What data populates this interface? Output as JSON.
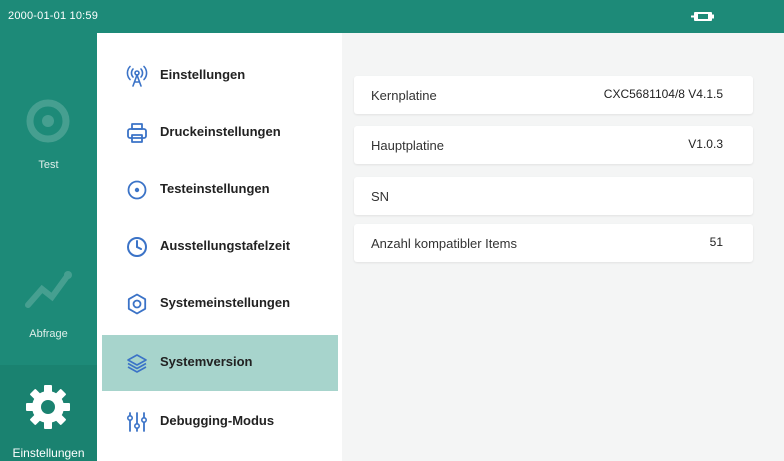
{
  "status_bar": {
    "datetime": "2000-01-01 10:59",
    "battery_icon": "battery-icon"
  },
  "left_nav": {
    "items": [
      {
        "label": "Test",
        "icon": "gear-icon",
        "active": false
      },
      {
        "label": "Abfrage",
        "icon": "query-icon",
        "active": false
      },
      {
        "label": "Einstellungen",
        "icon": "gear-icon",
        "active": true
      }
    ]
  },
  "submenu": {
    "items": [
      {
        "label": "Einstellungen",
        "icon": "signal-icon",
        "active": false
      },
      {
        "label": "Druckeinstellungen",
        "icon": "printer-icon",
        "active": false
      },
      {
        "label": "Testeinstellungen",
        "icon": "target-icon",
        "active": false
      },
      {
        "label": "Ausstellungstafelzeit",
        "icon": "clock-icon",
        "active": false
      },
      {
        "label": "Systemeinstellungen",
        "icon": "settings-icon",
        "active": false
      },
      {
        "label": "Systemversion",
        "icon": "layers-icon",
        "active": true
      },
      {
        "label": "Debugging-Modus",
        "icon": "sliders-icon",
        "active": false
      }
    ]
  },
  "version_info": {
    "rows": [
      {
        "label": "Kernplatine",
        "value": "CXC5681104/8 V4.1.5"
      },
      {
        "label": "Hauptplatine",
        "value": "V1.0.3"
      },
      {
        "label": "SN",
        "value": ""
      },
      {
        "label": "Anzahl kompatibler Items",
        "value": "51"
      }
    ]
  },
  "colors": {
    "accent": "#1d8a78",
    "active_item_bg": "#a7d4cc",
    "icon_blue": "#3b73c7"
  }
}
